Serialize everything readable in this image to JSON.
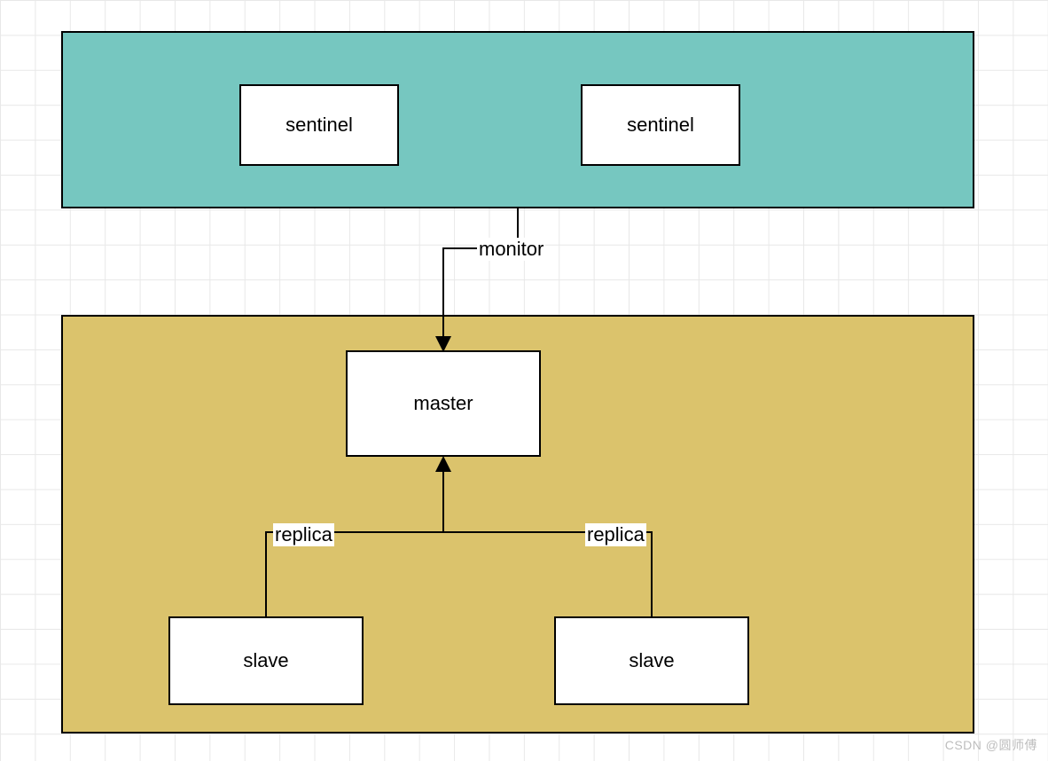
{
  "colors": {
    "sentinel_container": "#76c7c0",
    "cluster_container": "#dbc36c",
    "node_fill": "#ffffff",
    "border": "#000000"
  },
  "containers": {
    "top": {
      "role": "sentinel-group"
    },
    "bottom": {
      "role": "redis-cluster"
    }
  },
  "nodes": {
    "sentinel1": {
      "label": "sentinel"
    },
    "sentinel2": {
      "label": "sentinel"
    },
    "master": {
      "label": "master"
    },
    "slave1": {
      "label": "slave"
    },
    "slave2": {
      "label": "slave"
    }
  },
  "edges": {
    "monitor": {
      "label": "monitor",
      "from": "sentinel-group",
      "to": "master"
    },
    "replica1": {
      "label": "replica",
      "from": "slave1",
      "to": "master"
    },
    "replica2": {
      "label": "replica",
      "from": "slave2",
      "to": "master"
    }
  },
  "watermark": "CSDN @圆师傅"
}
